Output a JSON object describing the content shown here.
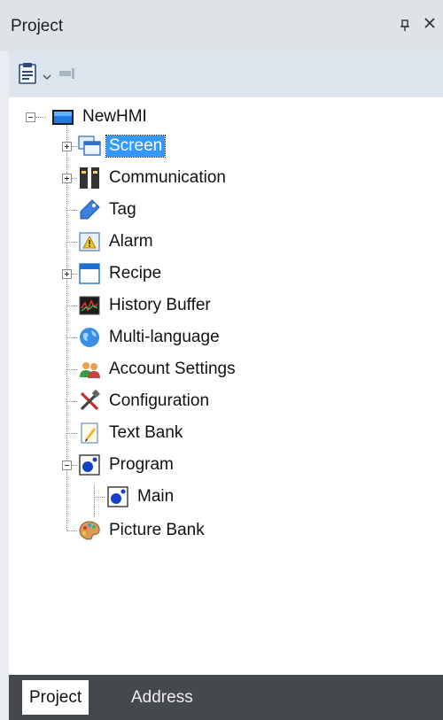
{
  "panel": {
    "title": "Project",
    "pin_glyph": "ᴜ",
    "close_glyph": "×"
  },
  "toolbar": {
    "buttons": [
      "project-settings-icon",
      "dropdown-arrow-icon",
      "restore-icon"
    ]
  },
  "tree": {
    "root": "NewHMI",
    "items": [
      {
        "label": "Screen",
        "icon": "screen-icon",
        "expandable": true,
        "selected": true
      },
      {
        "label": "Communication",
        "icon": "communication-icon",
        "expandable": true
      },
      {
        "label": "Tag",
        "icon": "tag-icon"
      },
      {
        "label": "Alarm",
        "icon": "alarm-icon"
      },
      {
        "label": "Recipe",
        "icon": "recipe-icon",
        "expandable": true
      },
      {
        "label": "History Buffer",
        "icon": "history-buffer-icon"
      },
      {
        "label": "Multi-language",
        "icon": "globe-icon"
      },
      {
        "label": "Account Settings",
        "icon": "users-icon"
      },
      {
        "label": "Configuration",
        "icon": "tools-icon"
      },
      {
        "label": "Text Bank",
        "icon": "notepad-icon"
      },
      {
        "label": "Program",
        "icon": "program-icon",
        "expanded": true
      },
      {
        "label": "Main",
        "icon": "program-icon",
        "child": true
      },
      {
        "label": "Picture Bank",
        "icon": "palette-icon"
      }
    ]
  },
  "tabs": [
    {
      "label": "Project",
      "active": true
    },
    {
      "label": "Address",
      "active": false
    }
  ],
  "colors": {
    "selection": "#3399ff",
    "tab_bar": "#45484d",
    "toolbar": "#dce4ee"
  }
}
